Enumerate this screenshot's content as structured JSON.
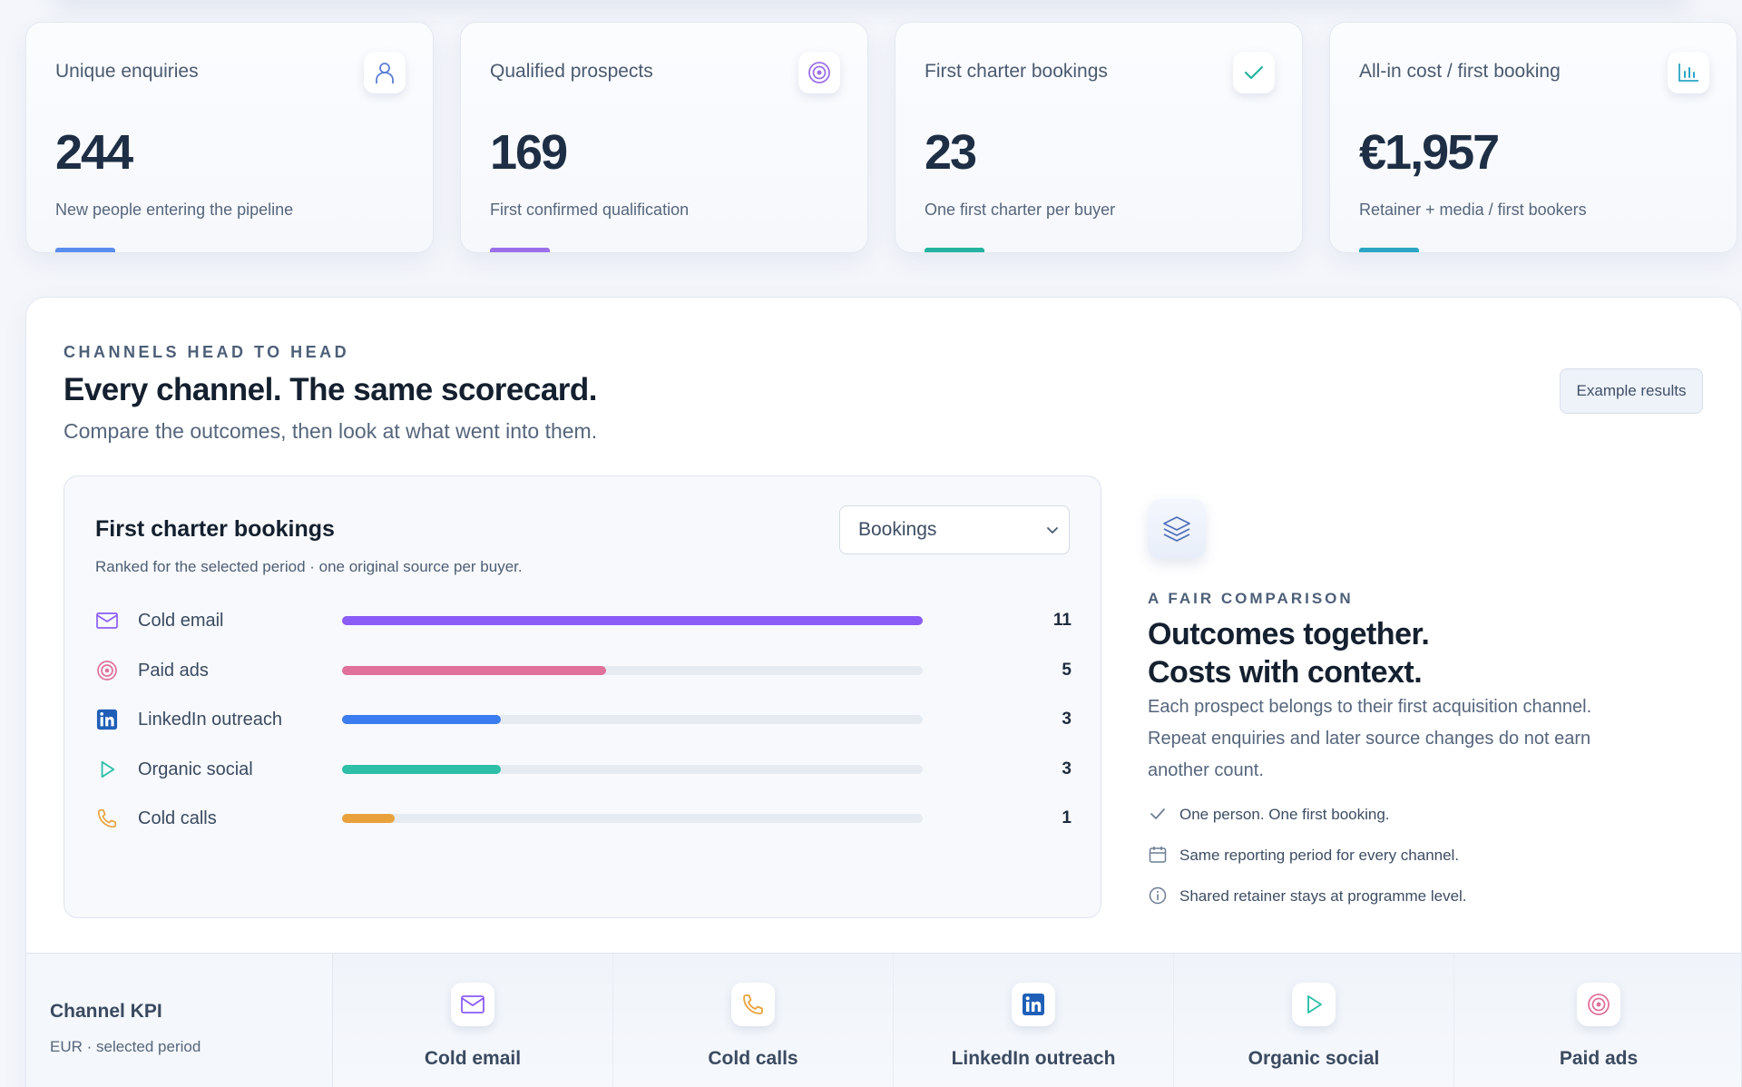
{
  "kpis": [
    {
      "title": "Unique enquiries",
      "value": "244",
      "desc": "New people entering the pipeline",
      "icon": "person-icon",
      "accent": "#5b8def"
    },
    {
      "title": "Qualified prospects",
      "value": "169",
      "desc": "First confirmed qualification",
      "icon": "target-icon",
      "accent": "#9b6fe8"
    },
    {
      "title": "First charter bookings",
      "value": "23",
      "desc": "One first charter per buyer",
      "icon": "check-icon",
      "accent": "#24b3a0"
    },
    {
      "title": "All-in cost / first booking",
      "value": "€1,957",
      "desc": "Retainer + media / first bookers",
      "icon": "bar-chart-icon",
      "accent": "#2aa5c4"
    }
  ],
  "section": {
    "eyebrow": "CHANNELS HEAD TO HEAD",
    "headline": "Every channel. The same scorecard.",
    "subline": "Compare the outcomes, then look at what went into them.",
    "example_button": "Example results"
  },
  "chart_card": {
    "title": "First charter bookings",
    "subtitle": "Ranked for the selected period · one original source per buyer.",
    "select_value": "Bookings"
  },
  "chart_data": {
    "type": "bar",
    "title": "First charter bookings",
    "categories": [
      "Cold email",
      "Paid ads",
      "LinkedIn outreach",
      "Organic social",
      "Cold calls"
    ],
    "values": [
      11,
      5,
      3,
      3,
      1
    ],
    "colors": [
      "#8b5cf6",
      "#e0719a",
      "#3b7cf0",
      "#2dbfa8",
      "#e9a23b"
    ],
    "icons": [
      "mail-icon",
      "target-icon",
      "linkedin-icon",
      "play-icon",
      "phone-icon"
    ],
    "xlim": [
      0,
      11
    ]
  },
  "info": {
    "eyebrow": "A FAIR COMPARISON",
    "head_line1": "Outcomes together.",
    "head_line2": "Costs with context.",
    "body": "Each prospect belongs to their first acquisition channel. Repeat enquiries and later source changes do not earn another count.",
    "checks": [
      {
        "icon": "check-icon",
        "text": "One person. One first booking."
      },
      {
        "icon": "calendar-icon",
        "text": "Same reporting period for every channel."
      },
      {
        "icon": "info-icon",
        "text": "Shared retainer stays at programme level."
      }
    ]
  },
  "kpi_table": {
    "title": "Channel KPI",
    "subtitle": "EUR · selected period",
    "columns": [
      {
        "label": "Cold email",
        "icon": "mail-icon"
      },
      {
        "label": "Cold calls",
        "icon": "phone-icon"
      },
      {
        "label": "LinkedIn outreach",
        "icon": "linkedin-icon"
      },
      {
        "label": "Organic social",
        "icon": "play-icon"
      },
      {
        "label": "Paid ads",
        "icon": "target-icon"
      }
    ]
  }
}
